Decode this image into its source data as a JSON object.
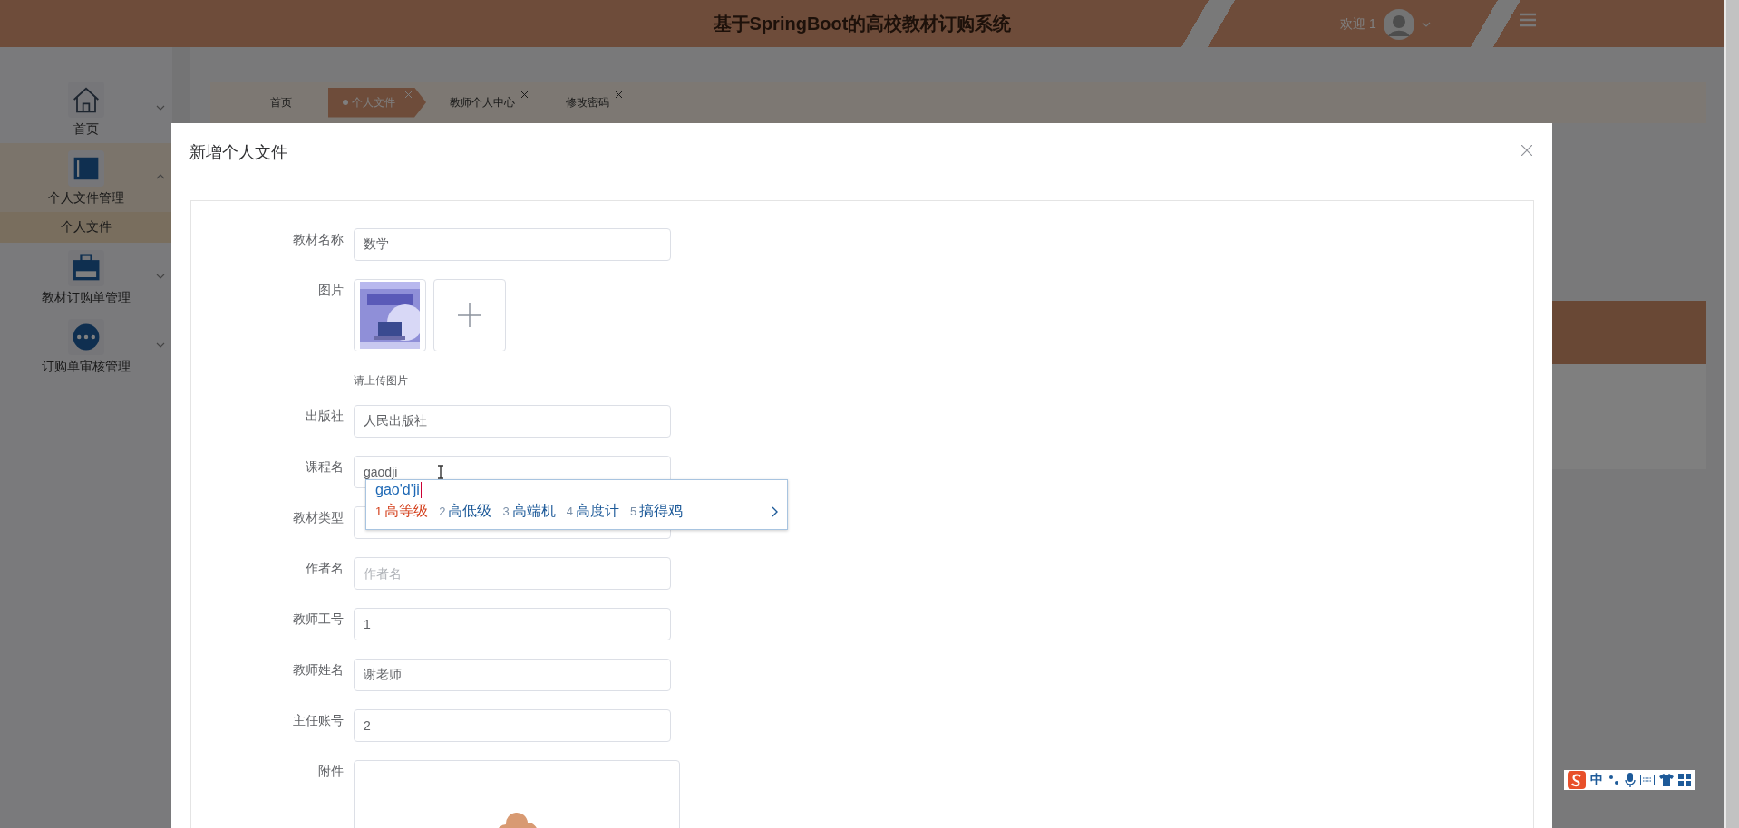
{
  "header": {
    "title": "基于SpringBoot的高校教材订购系统",
    "welcome": "欢迎 1"
  },
  "sidebar": {
    "items": [
      {
        "label": "首页",
        "expanded": false,
        "selected": false
      },
      {
        "label": "个人文件管理",
        "expanded": true,
        "selected": true,
        "children": [
          {
            "label": "个人文件",
            "selected": true
          }
        ]
      },
      {
        "label": "教材订购单管理",
        "expanded": false,
        "selected": false
      },
      {
        "label": "订购单审核管理",
        "expanded": false,
        "selected": false
      }
    ]
  },
  "tabs": [
    {
      "label": "首页",
      "selected": false,
      "closable": false
    },
    {
      "label": "个人文件",
      "selected": true,
      "closable": true
    },
    {
      "label": "教师个人中心",
      "selected": false,
      "closable": true
    },
    {
      "label": "修改密码",
      "selected": false,
      "closable": true
    }
  ],
  "dialog": {
    "title": "新增个人文件",
    "fields": [
      {
        "kind": "text",
        "label": "教材名称",
        "value": "数学"
      },
      {
        "label": "图片",
        "hint": "请上传图片"
      },
      {
        "kind": "text",
        "label": "出版社",
        "value": "人民出版社"
      },
      {
        "kind": "text",
        "label": "课程名",
        "value": "gaodji",
        "focused": true
      },
      {
        "kind": "text",
        "label": "教材类型"
      },
      {
        "kind": "text",
        "label": "作者名",
        "placeholder": "作者名"
      },
      {
        "kind": "text",
        "label": "教师工号",
        "value": "1"
      },
      {
        "kind": "text",
        "label": "教师姓名",
        "value": "谢老师"
      },
      {
        "kind": "text",
        "label": "主任账号",
        "value": "2"
      },
      {
        "kind": "file",
        "label": "附件"
      }
    ]
  },
  "ime": {
    "composition": "gao'd'ji",
    "candidates": [
      {
        "index": "1",
        "text": "高等级",
        "selected": true
      },
      {
        "index": "2",
        "text": "高低级",
        "selected": false
      },
      {
        "index": "3",
        "text": "高端机",
        "selected": false
      },
      {
        "index": "4",
        "text": "高度计",
        "selected": false
      },
      {
        "index": "5",
        "text": "搞得鸡",
        "selected": false
      }
    ]
  },
  "ime_toolbar": {
    "mode": "中"
  }
}
